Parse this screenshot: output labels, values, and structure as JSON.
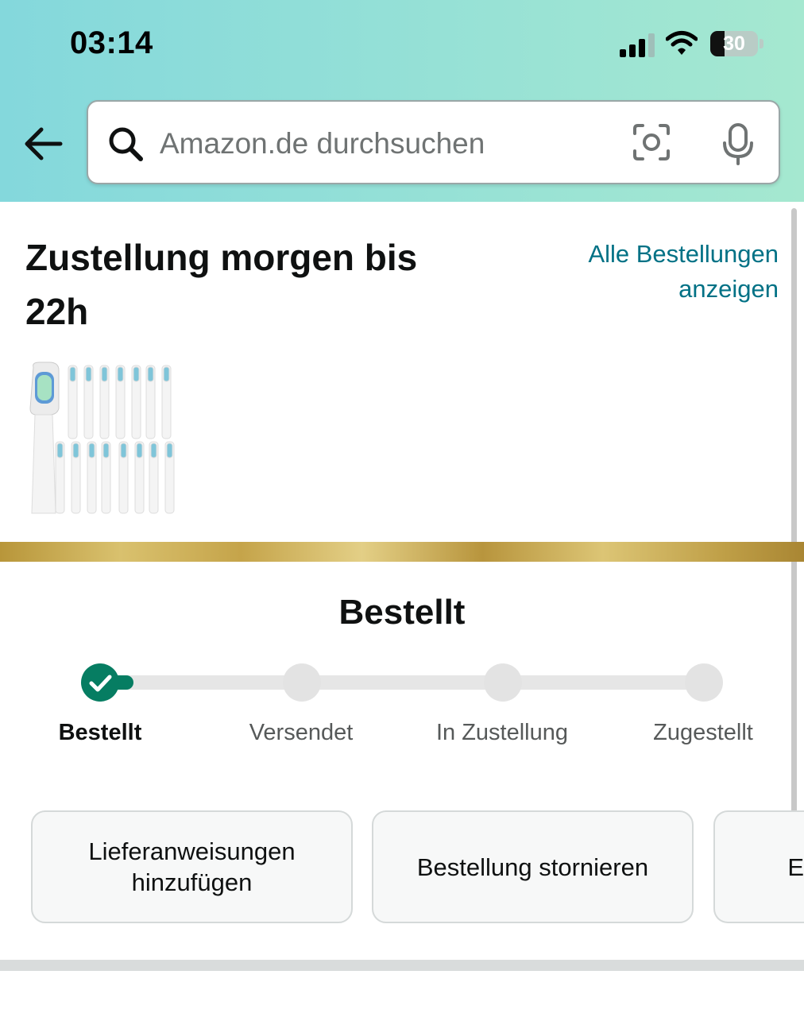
{
  "status_bar": {
    "time": "03:14",
    "battery": "30",
    "battery_level_percent": 30
  },
  "search": {
    "placeholder": "Amazon.de durchsuchen"
  },
  "icons": {
    "back": "arrow-left-icon",
    "search": "search-icon",
    "camera": "camera-scan-icon",
    "mic": "microphone-icon"
  },
  "delivery": {
    "title": "Zustellung morgen bis 22h",
    "all_orders_link": "Alle Bestellungen anzeigen"
  },
  "tracking": {
    "status_title": "Bestellt",
    "steps": [
      {
        "label": "Bestellt",
        "done": true
      },
      {
        "label": "Versendet",
        "done": false
      },
      {
        "label": "In Zustellung",
        "done": false
      },
      {
        "label": "Zugestellt",
        "done": false
      }
    ],
    "accent_color": "#067d62"
  },
  "actions": [
    {
      "label": "Lieferanweisungen hinzufügen"
    },
    {
      "label": "Bestellung stornieren"
    },
    {
      "label": "E"
    }
  ],
  "colors": {
    "link": "#007185",
    "header_gradient_start": "#84d8dc",
    "header_gradient_end": "#a5e8d0"
  }
}
